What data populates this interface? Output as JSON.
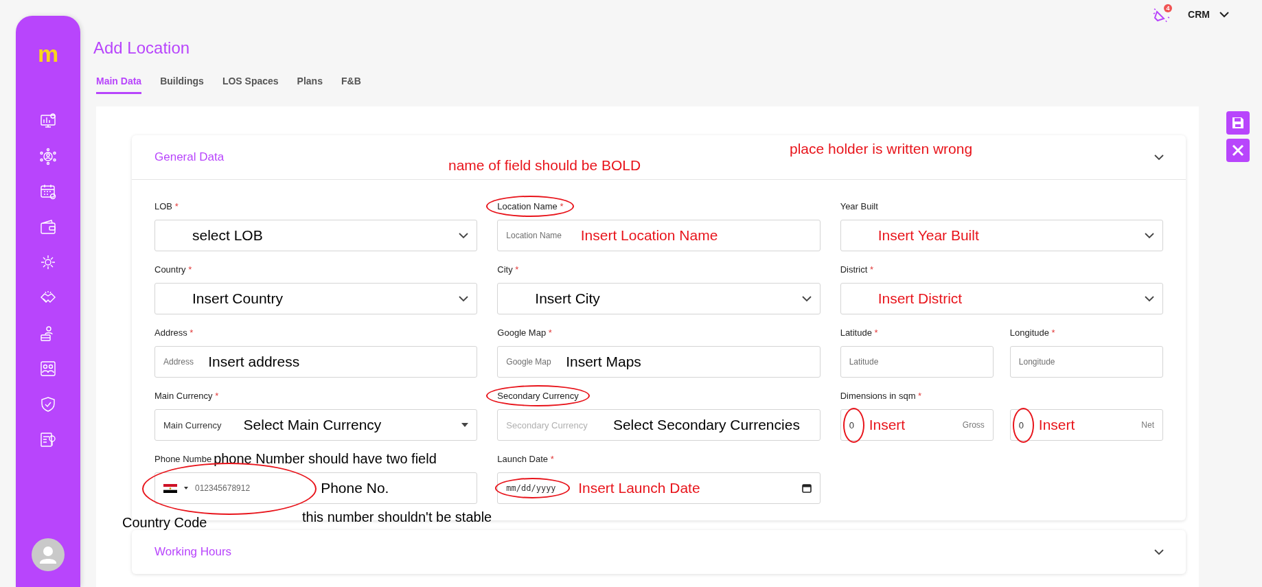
{
  "sidebar": {
    "logo": "m"
  },
  "topbar": {
    "notification_badge": "4",
    "menu": "CRM"
  },
  "title": "Add Location",
  "tabs": [
    {
      "label": "Main Data",
      "selected": true
    },
    {
      "label": "Buildings",
      "selected": false
    },
    {
      "label": "LOS Spaces",
      "selected": false
    },
    {
      "label": "Plans",
      "selected": false
    },
    {
      "label": "F&B",
      "selected": false
    }
  ],
  "sections": [
    {
      "title": "General Data",
      "expanded": true,
      "notes": [
        {
          "text": "name of field should be BOLD",
          "color": "#e8141b"
        },
        {
          "text": "place holder is written wrong",
          "color": "#e8141b"
        }
      ],
      "rows": [
        [
          {
            "kind": "select",
            "label": "LOB",
            "required_mark": "*",
            "label_circled": false,
            "input_circled": false,
            "note": {
              "text": "select LOB",
              "color": "#000000"
            }
          },
          {
            "kind": "input",
            "label": "Location Name",
            "required_mark": "*",
            "placeholder": "Location Name",
            "label_circled": true,
            "input_circled": false,
            "note": {
              "text": "Insert Location Name",
              "color": "#e8141b"
            }
          },
          {
            "kind": "select",
            "label": "Year Built",
            "label_circled": false,
            "input_circled": false,
            "note": {
              "text": "Insert Year Built",
              "color": "#e8141b"
            }
          }
        ],
        [
          {
            "kind": "select",
            "label": "Country",
            "required_mark": "*",
            "label_circled": false,
            "input_circled": false,
            "note": {
              "text": "Insert Country",
              "color": "#000000"
            }
          },
          {
            "kind": "select",
            "label": "City",
            "required_mark": "*",
            "label_circled": false,
            "input_circled": false,
            "note": {
              "text": "Insert City",
              "color": "#000000"
            }
          },
          {
            "kind": "select",
            "label": "District",
            "required_mark": "*",
            "label_circled": false,
            "input_circled": false,
            "note": {
              "text": "Insert District",
              "color": "#e8141b"
            }
          }
        ],
        [
          {
            "kind": "input",
            "label": "Address",
            "required_mark": "*",
            "placeholder": "Address",
            "label_circled": false,
            "input_circled": false,
            "note": {
              "text": "Insert address",
              "color": "#000000"
            }
          },
          {
            "kind": "input",
            "label": "Google Map",
            "required_mark": "*",
            "placeholder": "Google Map",
            "label_circled": false,
            "input_circled": false,
            "note": {
              "text": "Insert Maps",
              "color": "#000000"
            }
          },
          {
            "kind": "group",
            "fields": [
              {
                "kind": "input",
                "label": "Latitude",
                "required_mark": "*",
                "placeholder": "Latitude",
                "label_circled": false,
                "input_circled": false
              },
              {
                "kind": "input",
                "label": "Longitude",
                "required_mark": "*",
                "placeholder": "Longitude",
                "label_circled": false,
                "input_circled": false
              }
            ]
          }
        ],
        [
          {
            "kind": "dropdown",
            "label": "Main Currency",
            "required_mark": "*",
            "value": "Main Currency",
            "label_circled": false,
            "input_circled": false,
            "note": {
              "text": "Select Main Currency",
              "color": "#000000"
            }
          },
          {
            "kind": "dropdown",
            "label": "Secondary Currency",
            "placeholder": "Secondary Currency",
            "label_circled": true,
            "input_circled": false,
            "note": {
              "text": "Select Secondary Currencies",
              "color": "#000000"
            }
          },
          {
            "kind": "group",
            "label": "Dimensions in sqm",
            "required_mark": "*",
            "fields": [
              {
                "kind": "measure",
                "value": "0",
                "suffix": "Gross",
                "input_circled": true,
                "note": {
                  "text": "Insert",
                  "color": "#e8141b"
                }
              },
              {
                "kind": "measure",
                "value": "0",
                "suffix": "Net",
                "input_circled": true,
                "note": {
                  "text": "Insert",
                  "color": "#e8141b"
                }
              }
            ]
          }
        ],
        [
          {
            "kind": "phone",
            "label": "Phone Numbe",
            "placeholder": "012345678912",
            "label_circled": false,
            "input_circled": true,
            "label_note": {
              "text": "phone Number should have two field",
              "color": "#000000"
            },
            "note": {
              "text": "Phone No.",
              "color": "#000000"
            },
            "outside_notes": [
              {
                "text": "Country Code",
                "color": "#000000"
              },
              {
                "text": "this number shouldn't be stable",
                "color": "#000000"
              }
            ]
          },
          {
            "kind": "date",
            "label": "Launch Date",
            "required_mark": "*",
            "placeholder": "mm/dd/yyyy",
            "label_circled": false,
            "input_circled": true,
            "note": {
              "text": "Insert Launch Date",
              "color": "#e8141b"
            }
          }
        ]
      ]
    },
    {
      "title": "Working Hours",
      "expanded": false
    }
  ]
}
